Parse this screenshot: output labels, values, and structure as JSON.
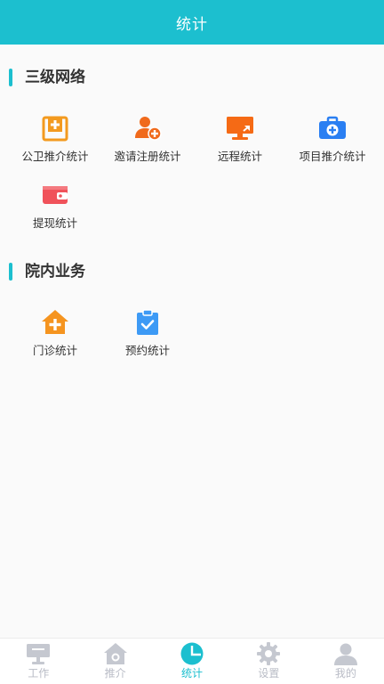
{
  "header": {
    "title": "统计"
  },
  "sections": [
    {
      "title": "三级网络",
      "items": [
        {
          "label": "公卫推介统计",
          "icon": "hospital-plus-icon",
          "color": "#f39a1f"
        },
        {
          "label": "邀请注册统计",
          "icon": "add-user-icon",
          "color": "#f06a1c"
        },
        {
          "label": "远程统计",
          "icon": "remote-monitor-icon",
          "color": "#f56a15"
        },
        {
          "label": "项目推介统计",
          "icon": "medical-kit-icon",
          "color": "#2a7ff2"
        },
        {
          "label": "提现统计",
          "icon": "wallet-icon",
          "color": "#f0525a"
        }
      ]
    },
    {
      "title": "院内业务",
      "items": [
        {
          "label": "门诊统计",
          "icon": "clinic-house-icon",
          "color": "#f5941f"
        },
        {
          "label": "预约统计",
          "icon": "appointment-clipboard-icon",
          "color": "#3d9af5"
        }
      ]
    }
  ],
  "tabbar": {
    "items": [
      {
        "label": "工作",
        "icon": "workstation-icon",
        "active": false
      },
      {
        "label": "推介",
        "icon": "home-camera-icon",
        "active": false
      },
      {
        "label": "统计",
        "icon": "pie-chart-icon",
        "active": true
      },
      {
        "label": "设置",
        "icon": "gear-icon",
        "active": false
      },
      {
        "label": "我的",
        "icon": "user-icon",
        "active": false
      }
    ],
    "active_color": "#1cbfcf",
    "inactive_color": "#b9bcc6"
  }
}
